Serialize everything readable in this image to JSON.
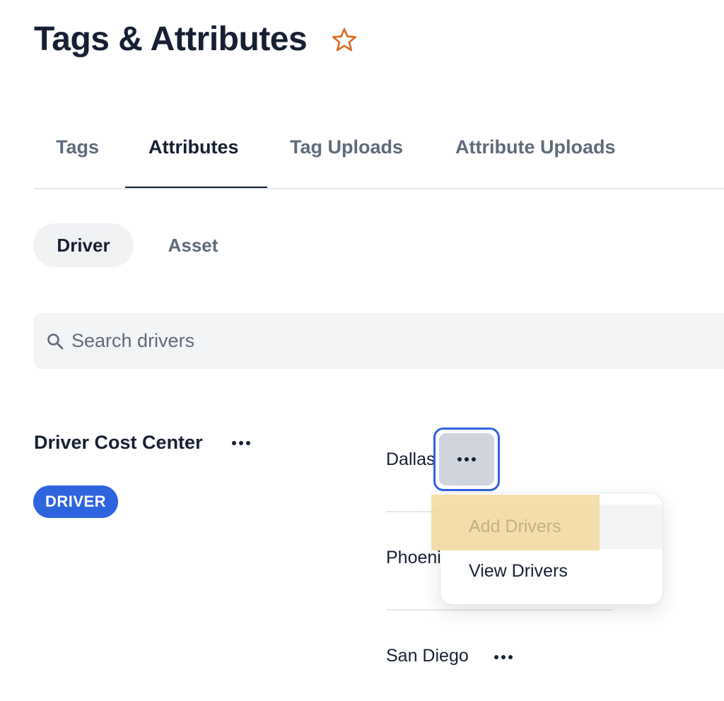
{
  "header": {
    "title": "Tags & Attributes",
    "favorite_icon": "star-outline-icon",
    "favorite_color": "#d9691f"
  },
  "tabs": [
    {
      "label": "Tags",
      "active": false
    },
    {
      "label": "Attributes",
      "active": true
    },
    {
      "label": "Tag Uploads",
      "active": false
    },
    {
      "label": "Attribute Uploads",
      "active": false
    }
  ],
  "entity_toggle": [
    {
      "label": "Driver",
      "active": true
    },
    {
      "label": "Asset",
      "active": false
    }
  ],
  "search": {
    "placeholder": "Search drivers",
    "value": "",
    "icon": "search-icon"
  },
  "attribute": {
    "name": "Driver Cost Center",
    "badge": "DRIVER",
    "badge_color": "#2f64df",
    "values": [
      {
        "label": "Dallas"
      },
      {
        "label": "Phoenix"
      },
      {
        "label": "San Diego"
      }
    ]
  },
  "context_menu": {
    "items": [
      {
        "label": "Add Drivers",
        "highlighted": true
      },
      {
        "label": "View Drivers",
        "highlighted": false
      }
    ]
  }
}
